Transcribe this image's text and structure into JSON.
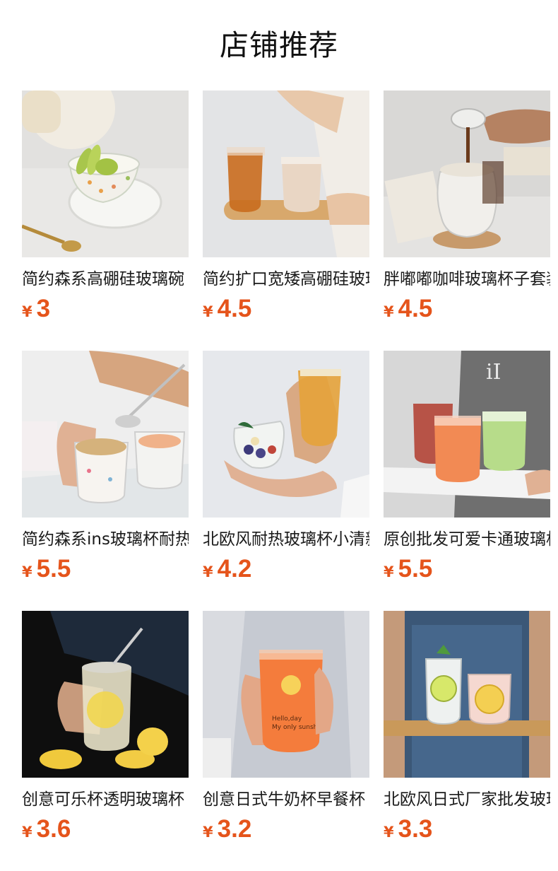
{
  "header": {
    "title": "店铺推荐"
  },
  "currency_symbol": "¥",
  "products": [
    {
      "name": "简约森系高硼硅玻璃碗",
      "price": "3"
    },
    {
      "name": "简约扩口宽矮高硼硅玻璃杯",
      "price": "4.5"
    },
    {
      "name": "胖嘟嘟咖啡玻璃杯子套装",
      "price": "4.5"
    },
    {
      "name": "简约森系ins玻璃杯耐热",
      "price": "5.5"
    },
    {
      "name": "北欧风耐热玻璃杯小清新",
      "price": "4.2"
    },
    {
      "name": "原创批发可爱卡通玻璃杯",
      "price": "5.5"
    },
    {
      "name": "创意可乐杯透明玻璃杯",
      "price": "3.6"
    },
    {
      "name": "创意日式牛奶杯早餐杯",
      "price": "3.2"
    },
    {
      "name": "北欧风日式厂家批发玻璃杯",
      "price": "3.3"
    }
  ]
}
